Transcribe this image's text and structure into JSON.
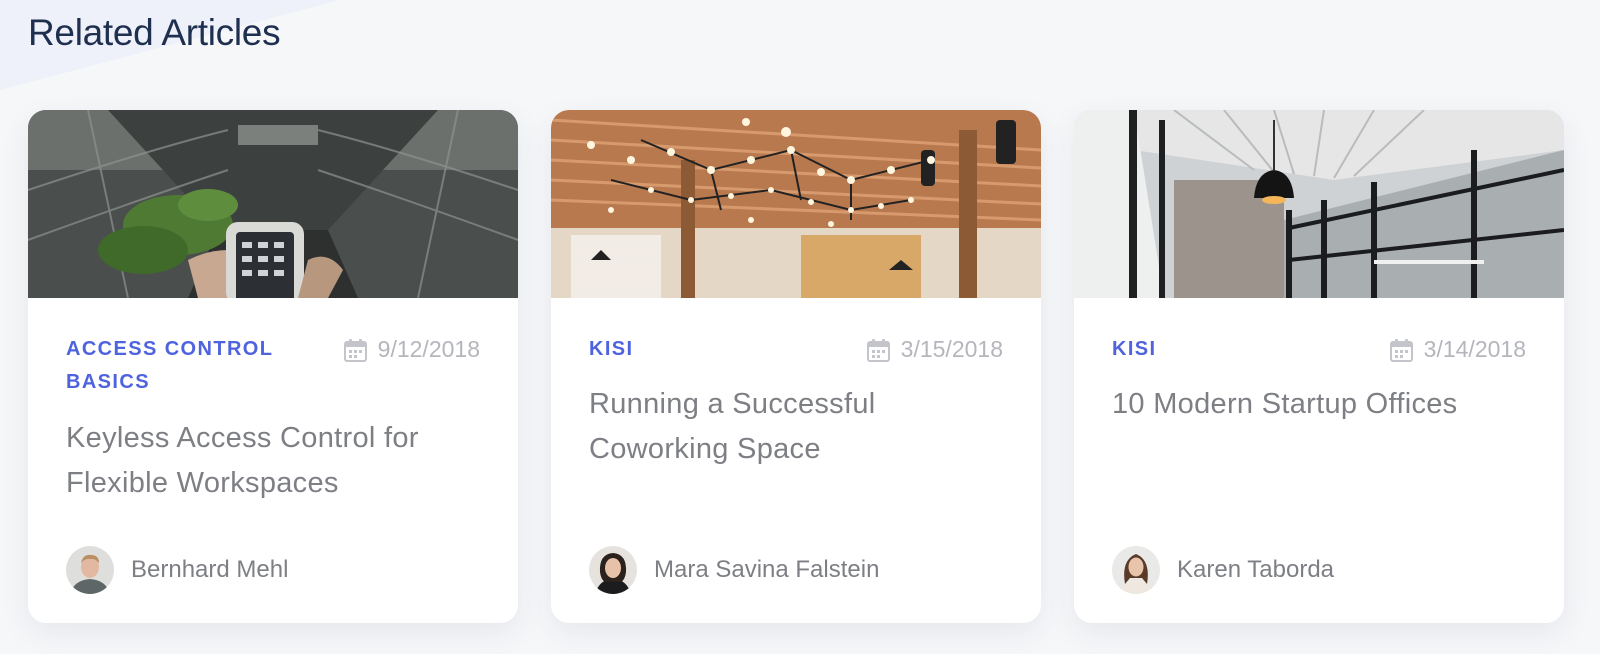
{
  "section": {
    "title": "Related Articles"
  },
  "colors": {
    "accent": "#4f63de",
    "title": "#1e2f4f",
    "muted": "#b4b6bc",
    "text": "#7d7f84"
  },
  "icons": {
    "date": "calendar-icon"
  },
  "articles": [
    {
      "category": "ACCESS CONTROL BASICS",
      "date": "9/12/2018",
      "title": "Keyless Access Control for Flexible Workspaces",
      "author": "Bernhard Mehl"
    },
    {
      "category": "KISI",
      "date": "3/15/2018",
      "title": "Running a Successful Coworking Space",
      "author": "Mara Savina Falstein"
    },
    {
      "category": "KISI",
      "date": "3/14/2018",
      "title": "10 Modern Startup Offices",
      "author": "Karen Taborda"
    }
  ]
}
